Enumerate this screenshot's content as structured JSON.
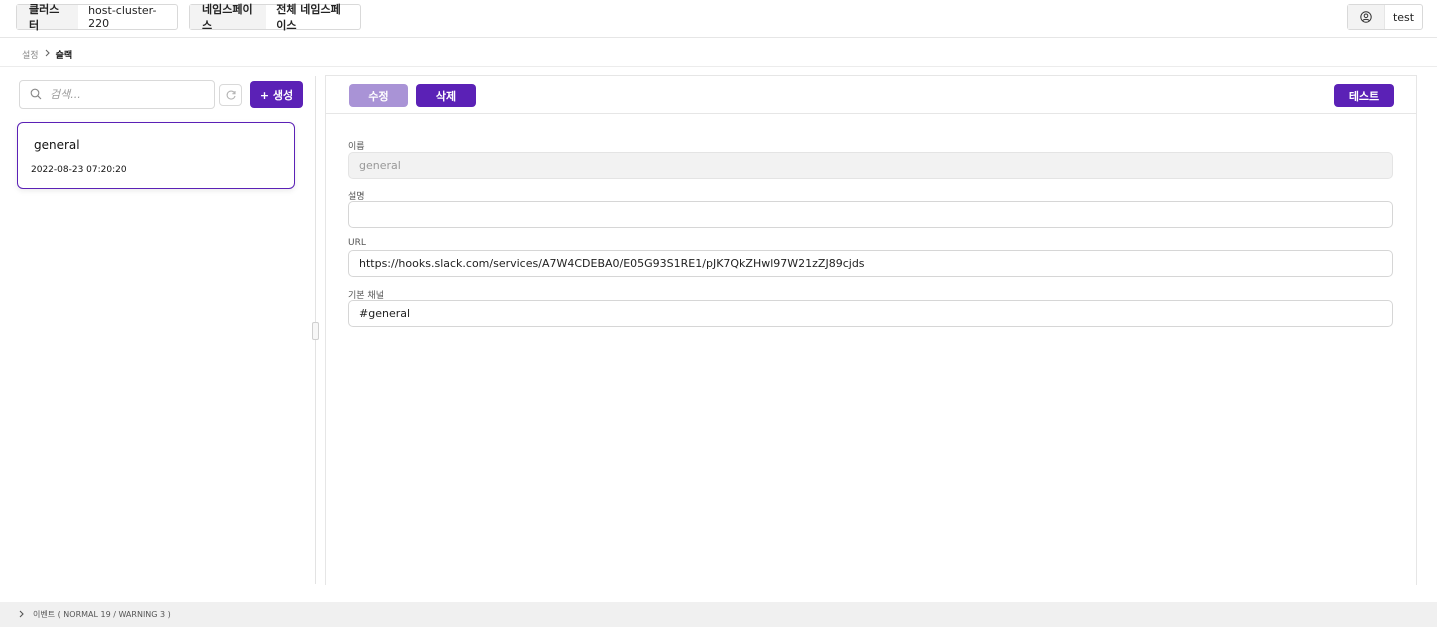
{
  "topbar": {
    "cluster_label": "클러스터",
    "cluster_value": "host-cluster-220",
    "namespace_label": "네임스페이스",
    "namespace_value": "전체 네임스페이스",
    "user_name": "test"
  },
  "breadcrumb": {
    "parent": "설정",
    "current": "슬랙"
  },
  "list": {
    "search_placeholder": "검색...",
    "create_label": "+ 생성",
    "items": [
      {
        "title": "general",
        "date": "2022-08-23 07:20:20"
      }
    ]
  },
  "detail": {
    "edit_label": "수정",
    "delete_label": "삭제",
    "test_label": "테스트",
    "fields": {
      "name": {
        "label": "이름",
        "value": "general"
      },
      "description": {
        "label": "설명",
        "value": ""
      },
      "url": {
        "label": "URL",
        "value": "https://hooks.slack.com/services/A7W4CDEBA0/E05G93S1RE1/pJK7QkZHwl97W21zZJ89cjds"
      },
      "channel": {
        "label": "기본 채널",
        "value": "#general"
      }
    }
  },
  "events": {
    "label": "이벤트 ( NORMAL 19 / WARNING 3 )"
  },
  "colors": {
    "accent": "#5b21b6",
    "accent_disabled": "#a993d6"
  },
  "icons": [
    "search-icon",
    "refresh-icon",
    "user-icon",
    "chevron-right-icon"
  ]
}
